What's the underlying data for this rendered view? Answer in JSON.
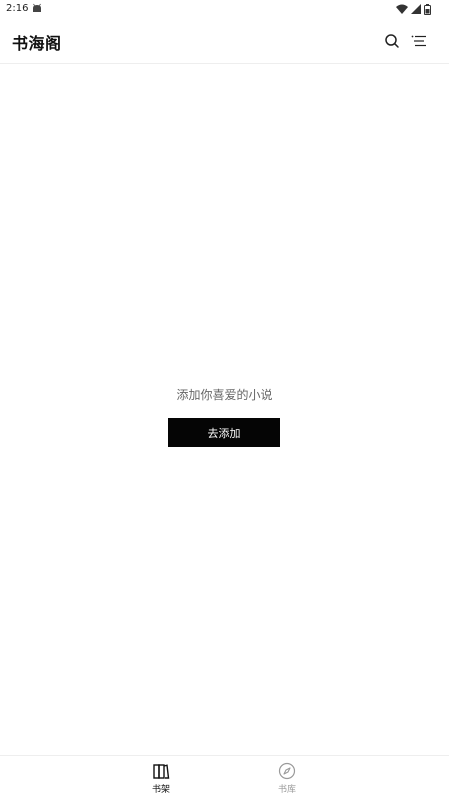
{
  "status_bar": {
    "time": "2:16",
    "icons": [
      "android-notification-icon",
      "wifi-icon",
      "signal-icon",
      "battery-icon"
    ]
  },
  "app_bar": {
    "title": "书海阁",
    "actions": [
      "search-icon",
      "menu-list-icon"
    ]
  },
  "empty_state": {
    "message": "添加你喜爱的小说",
    "button_label": "去添加"
  },
  "bottom_nav": {
    "items": [
      {
        "label": "书架",
        "icon": "bookshelf-icon",
        "active": true
      },
      {
        "label": "书库",
        "icon": "compass-icon",
        "active": false
      }
    ]
  },
  "colors": {
    "accent": "#050505",
    "inactive": "#9a9a9a",
    "background": "#ffffff"
  }
}
